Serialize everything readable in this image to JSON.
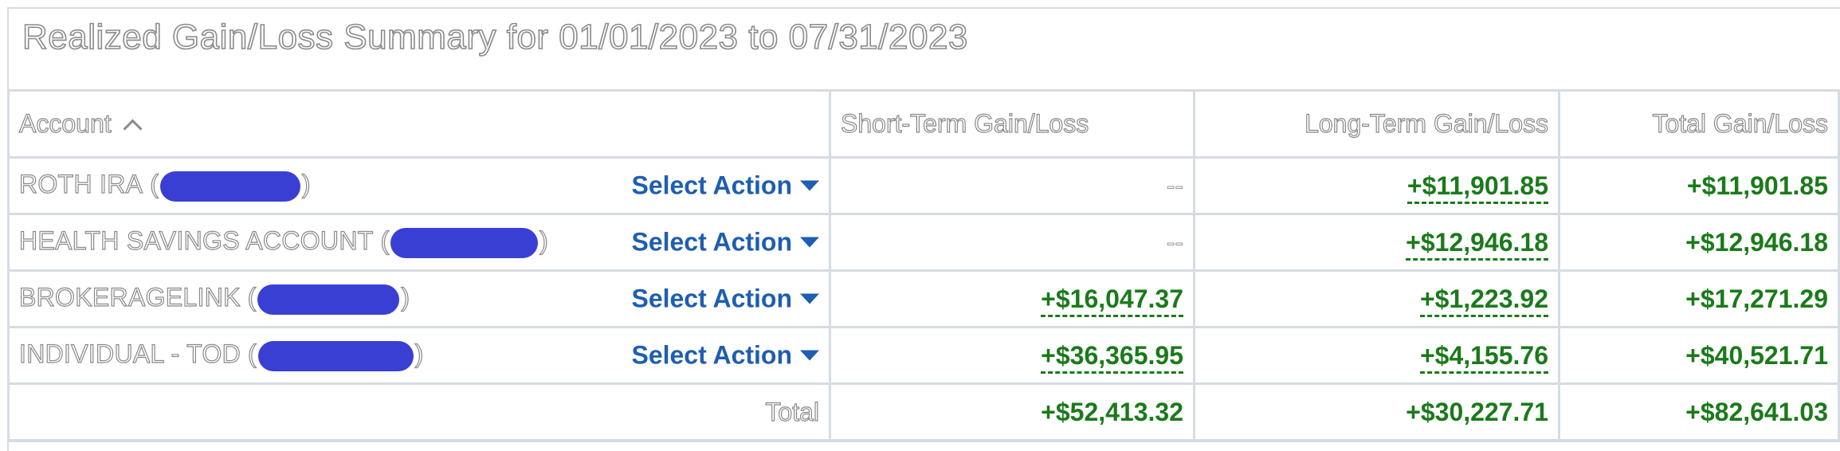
{
  "title": "Realized Gain/Loss Summary for 01/01/2023 to 07/31/2023",
  "headers": {
    "account": "Account",
    "short_term": "Short-Term Gain/Loss",
    "long_term": "Long-Term Gain/Loss",
    "total": "Total Gain/Loss"
  },
  "select_action_label": "Select Action",
  "rows": [
    {
      "name": "ROTH IRA",
      "short_term": "--",
      "long_term": "+$11,901.85",
      "total": "+$11,901.85"
    },
    {
      "name": "HEALTH SAVINGS ACCOUNT",
      "short_term": "--",
      "long_term": "+$12,946.18",
      "total": "+$12,946.18"
    },
    {
      "name": "BROKERAGELINK",
      "short_term": "+$16,047.37",
      "long_term": "+$1,223.92",
      "total": "+$17,271.29"
    },
    {
      "name": "INDIVIDUAL - TOD",
      "short_term": "+$36,365.95",
      "long_term": "+$4,155.76",
      "total": "+$40,521.71"
    }
  ],
  "totals": {
    "label": "Total",
    "short_term": "+$52,413.32",
    "long_term": "+$30,227.71",
    "total": "+$82,641.03"
  },
  "colors": {
    "gain": "#1a7a1a",
    "link": "#1f5eb0",
    "redaction": "#3a3fd4",
    "border": "#d6dce3"
  },
  "icons": {
    "sort": "sort-ascending-icon",
    "dropdown": "chevron-down-icon"
  }
}
